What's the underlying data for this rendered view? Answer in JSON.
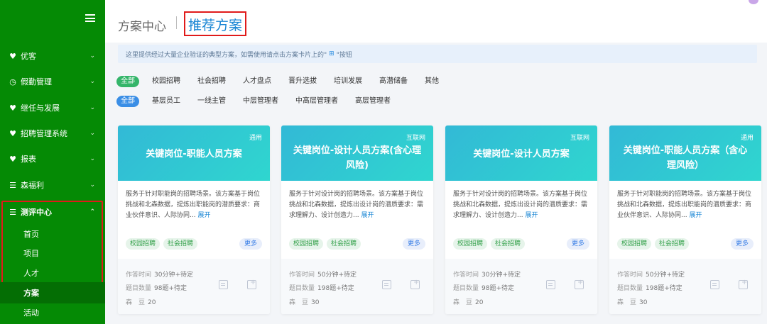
{
  "sidebar": {
    "items": [
      {
        "icon": "diamond-icon",
        "glyph": "♥",
        "label": "优客"
      },
      {
        "icon": "clock-icon",
        "glyph": "◷",
        "label": "假勤管理"
      },
      {
        "icon": "diamond-icon",
        "glyph": "♥",
        "label": "继任与发展"
      },
      {
        "icon": "diamond-icon",
        "glyph": "♥",
        "label": "招聘管理系统"
      },
      {
        "icon": "diamond-icon",
        "glyph": "♥",
        "label": "报表"
      },
      {
        "icon": "document-icon",
        "glyph": "☰",
        "label": "森福利"
      }
    ],
    "active_group": {
      "icon": "document-icon",
      "glyph": "☰",
      "label": "测评中心"
    },
    "sub_items": [
      "首页",
      "项目",
      "人才",
      "方案",
      "活动"
    ],
    "current_sub_index": 3,
    "chevron": "⌄",
    "chevron_up": "⌃"
  },
  "header": {
    "crumb_parent": "方案中心",
    "crumb_current": "推荐方案"
  },
  "notice": {
    "text_before": "这里提供经过大量企业验证的典型方案，如需使用请点击方案卡片上的\"",
    "icon": "add-to-plan-icon",
    "text_after": "\"按钮"
  },
  "filters": {
    "row1": [
      "全部",
      "校园招聘",
      "社会招聘",
      "人才盘点",
      "晋升选拔",
      "培训发展",
      "高潜储备",
      "其他"
    ],
    "row2": [
      "全部",
      "基层员工",
      "一线主管",
      "中层管理者",
      "中高层管理者",
      "高层管理者"
    ]
  },
  "cards": [
    {
      "badge": "通用",
      "title": "关键岗位-职能人员方案",
      "desc": "服务于针对职能岗的招聘场景。该方案基于岗位挑战和北森数据，提炼出职能岗的潜质要求：商业伙伴意识、人际协同...",
      "expand": "展开",
      "tags": [
        "校园招聘",
        "社会招聘"
      ],
      "more": "更多",
      "time_label": "作答时间",
      "time": "30分钟+待定",
      "count_label": "题目数量",
      "count": "98题+待定",
      "beans_label": "森　豆",
      "beans": "20"
    },
    {
      "badge": "互联网",
      "title": "关键岗位-设计人员方案(含心理风险)",
      "desc": "服务于针对设计岗的招聘场景。该方案基于岗位挑战和北森数据，提炼出设计岗的潜质要求：需求理解力、设计创造力...",
      "expand": "展开",
      "tags": [
        "校园招聘",
        "社会招聘"
      ],
      "more": "更多",
      "time_label": "作答时间",
      "time": "50分钟+待定",
      "count_label": "题目数量",
      "count": "198题+待定",
      "beans_label": "森　豆",
      "beans": "30"
    },
    {
      "badge": "互联网",
      "title": "关键岗位-设计人员方案",
      "desc": "服务于针对设计岗的招聘场景。该方案基于岗位挑战和北森数据，提炼出设计岗的潜质要求：需求理解力、设计创造力...",
      "expand": "展开",
      "tags": [
        "校园招聘",
        "社会招聘"
      ],
      "more": "更多",
      "time_label": "作答时间",
      "time": "30分钟+待定",
      "count_label": "题目数量",
      "count": "98题+待定",
      "beans_label": "森　豆",
      "beans": "20"
    },
    {
      "badge": "通用",
      "title": "关键岗位-职能人员方案（含心理风险）",
      "desc": "服务于针对职能岗的招聘场景。该方案基于岗位挑战和北森数据，提炼出职能岗的潜质要求：商业伙伴意识、人际协同...",
      "expand": "展开",
      "tags": [
        "校园招聘",
        "社会招聘"
      ],
      "more": "更多",
      "time_label": "作答时间",
      "time": "50分钟+待定",
      "count_label": "题目数量",
      "count": "198题+待定",
      "beans_label": "森　豆",
      "beans": "30"
    }
  ],
  "colors": {
    "sidebar": "#058a05",
    "highlight_box": "#e01a1a",
    "accent_blue": "#1a86d4",
    "card_head": "#32b9d6"
  }
}
